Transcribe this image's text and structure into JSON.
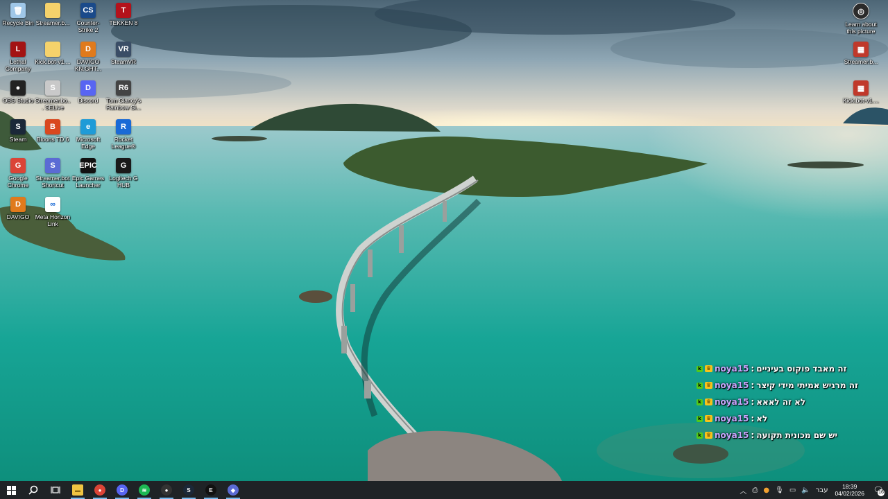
{
  "desktop": {
    "left_icons": [
      {
        "label": "Recycle Bin",
        "glyph": "🗑",
        "color": "#9fc7e8",
        "icon": "recycle-bin-icon"
      },
      {
        "label": "Streamer.b...",
        "glyph": "",
        "color": "#f5d26b",
        "icon": "folder-icon"
      },
      {
        "label": "Counter-Strike 2",
        "glyph": "CS",
        "color": "#1a4a8a",
        "icon": "counter-strike-icon"
      },
      {
        "label": "TEKKEN 8",
        "glyph": "T",
        "color": "#b4121b",
        "icon": "tekken-icon"
      },
      {
        "label": "Lethal Company",
        "glyph": "L",
        "color": "#a31313",
        "icon": "lethal-company-icon"
      },
      {
        "label": "Kick.bot-v1....",
        "glyph": "",
        "color": "#f5d26b",
        "icon": "folder-icon"
      },
      {
        "label": "DAVIGO KN.GHT...",
        "glyph": "D",
        "color": "#e07a1c",
        "icon": "davigo-icon"
      },
      {
        "label": "SteamVR",
        "glyph": "VR",
        "color": "#3a4d66",
        "icon": "steamvr-icon"
      },
      {
        "label": "OBS Studio",
        "glyph": "●",
        "color": "#222222",
        "icon": "obs-icon"
      },
      {
        "label": "Streamer.bo... SELive",
        "glyph": "S",
        "color": "#c9c9c9",
        "icon": "streamer-bot-icon"
      },
      {
        "label": "Discord",
        "glyph": "D",
        "color": "#5865f2",
        "icon": "discord-icon"
      },
      {
        "label": "Tom Clancy's Rainbow Si...",
        "glyph": "R6",
        "color": "#444444",
        "icon": "rainbow-six-icon"
      },
      {
        "label": "Steam",
        "glyph": "S",
        "color": "#1b2838",
        "icon": "steam-icon"
      },
      {
        "label": "Bloons TD 6",
        "glyph": "B",
        "color": "#d9481f",
        "icon": "bloons-icon"
      },
      {
        "label": "Microsoft Edge",
        "glyph": "e",
        "color": "#1f9bd7",
        "icon": "edge-icon"
      },
      {
        "label": "Rocket League®",
        "glyph": "R",
        "color": "#1a6ad6",
        "icon": "rocket-league-icon"
      },
      {
        "label": "Google Chrome",
        "glyph": "G",
        "color": "#db4437",
        "icon": "chrome-icon"
      },
      {
        "label": "Streamer.bot Shortcut",
        "glyph": "S",
        "color": "#5b6bd4",
        "icon": "streamer-bot-shortcut-icon"
      },
      {
        "label": "Epic Games Launcher",
        "glyph": "EPIC",
        "color": "#111111",
        "icon": "epic-games-icon"
      },
      {
        "label": "Logitech G HUB",
        "glyph": "G",
        "color": "#1a1a1a",
        "icon": "logitech-icon"
      },
      {
        "label": "DAVIGO",
        "glyph": "D",
        "color": "#e07a1c",
        "icon": "davigo-icon"
      },
      {
        "label": "Meta Horizon Link",
        "glyph": "∞",
        "color": "#ffffff",
        "icon": "meta-icon"
      }
    ],
    "right_icons": [
      {
        "label": "Learn about this picture",
        "glyph": "◎",
        "color": "#2b2b2b",
        "icon": "learn-about-picture-icon"
      },
      {
        "label": "Streamer.b...",
        "glyph": "▦",
        "color": "#c0392b",
        "icon": "archive-icon"
      },
      {
        "label": "Kick.bot-v1....",
        "glyph": "▦",
        "color": "#c0392b",
        "icon": "archive-icon"
      }
    ]
  },
  "chat": {
    "messages": [
      {
        "user": "noya15",
        "sep": ":",
        "text": "זה מאבד פוקוס בעיניים"
      },
      {
        "user": "noya15",
        "sep": ":",
        "text": "זה מרגיש אמיתי מידי קיצר"
      },
      {
        "user": "noya15",
        "sep": ":",
        "text": "לא זה לאאא"
      },
      {
        "user": "noya15",
        "sep": ":",
        "text": "לא"
      },
      {
        "user": "noya15",
        "sep": ":",
        "text": "יש שם מכונית תקועה"
      }
    ]
  },
  "taskbar": {
    "apps": [
      {
        "name": "file-explorer",
        "glyph": "▬",
        "color": "#f0c442"
      },
      {
        "name": "chrome",
        "glyph": "●",
        "color": "#db4437"
      },
      {
        "name": "discord",
        "glyph": "D",
        "color": "#5865f2"
      },
      {
        "name": "spotify",
        "glyph": "≋",
        "color": "#1db954"
      },
      {
        "name": "obs",
        "glyph": "●",
        "color": "#333333"
      },
      {
        "name": "steam",
        "glyph": "S",
        "color": "#1b2838"
      },
      {
        "name": "epic-games",
        "glyph": "E",
        "color": "#111111"
      },
      {
        "name": "streamer-bot",
        "glyph": "◆",
        "color": "#5b6bd4"
      }
    ],
    "language": "עבר",
    "time": "18:39",
    "date": "04/02/2026",
    "notification_count": "16"
  },
  "colors": {
    "taskbar_bg": "#1f2326",
    "chat_username": "#c9a7ff",
    "water": "#1aa59a"
  }
}
